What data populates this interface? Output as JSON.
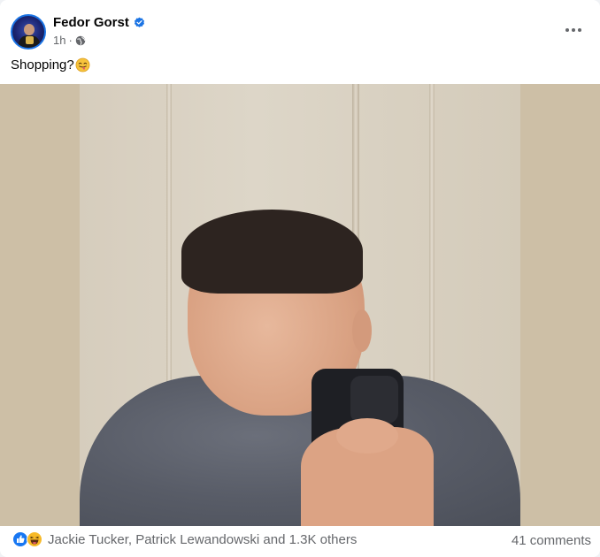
{
  "post": {
    "author": "Fedor Gorst",
    "verified": true,
    "timestamp": "1h",
    "separator": "·",
    "audience_icon": "globe-icon",
    "text": "Shopping?",
    "emoji": "face-with-tongue-icon",
    "photo_description_icon": "mirror-selfie-photo"
  },
  "engagement": {
    "reaction_icons": [
      "like-icon",
      "haha-icon"
    ],
    "reactors_text": "Jackie Tucker, Patrick Lewandowski and 1.3K others",
    "comments_text": "41 comments"
  },
  "colors": {
    "accent": "#1b74e4",
    "secondary_text": "#65676b",
    "primary_text": "#050505",
    "like_blue": "#1877f2",
    "haha_yellow": "#f7b928"
  }
}
